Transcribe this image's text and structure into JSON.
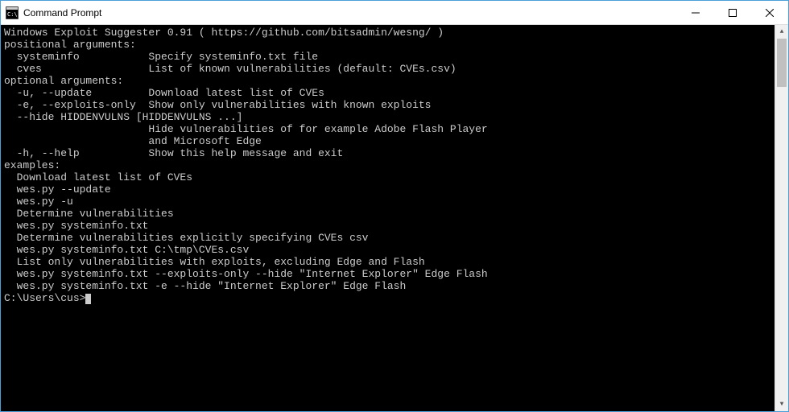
{
  "window": {
    "title": "Command Prompt"
  },
  "terminal": {
    "lines": [
      "Windows Exploit Suggester 0.91 ( https://github.com/bitsadmin/wesng/ )",
      "",
      "positional arguments:",
      "  systeminfo           Specify systeminfo.txt file",
      "  cves                 List of known vulnerabilities (default: CVEs.csv)",
      "",
      "optional arguments:",
      "  -u, --update         Download latest list of CVEs",
      "  -e, --exploits-only  Show only vulnerabilities with known exploits",
      "  --hide HIDDENVULNS [HIDDENVULNS ...]",
      "                       Hide vulnerabilities of for example Adobe Flash Player",
      "                       and Microsoft Edge",
      "  -h, --help           Show this help message and exit",
      "",
      "examples:",
      "  Download latest list of CVEs",
      "  wes.py --update",
      "  wes.py -u",
      "",
      "  Determine vulnerabilities",
      "  wes.py systeminfo.txt",
      "",
      "  Determine vulnerabilities explicitly specifying CVEs csv",
      "  wes.py systeminfo.txt C:\\tmp\\CVEs.csv",
      "",
      "  List only vulnerabilities with exploits, excluding Edge and Flash",
      "  wes.py systeminfo.txt --exploits-only --hide \"Internet Explorer\" Edge Flash",
      "  wes.py systeminfo.txt -e --hide \"Internet Explorer\" Edge Flash",
      ""
    ],
    "prompt": "C:\\Users\\cus>"
  }
}
